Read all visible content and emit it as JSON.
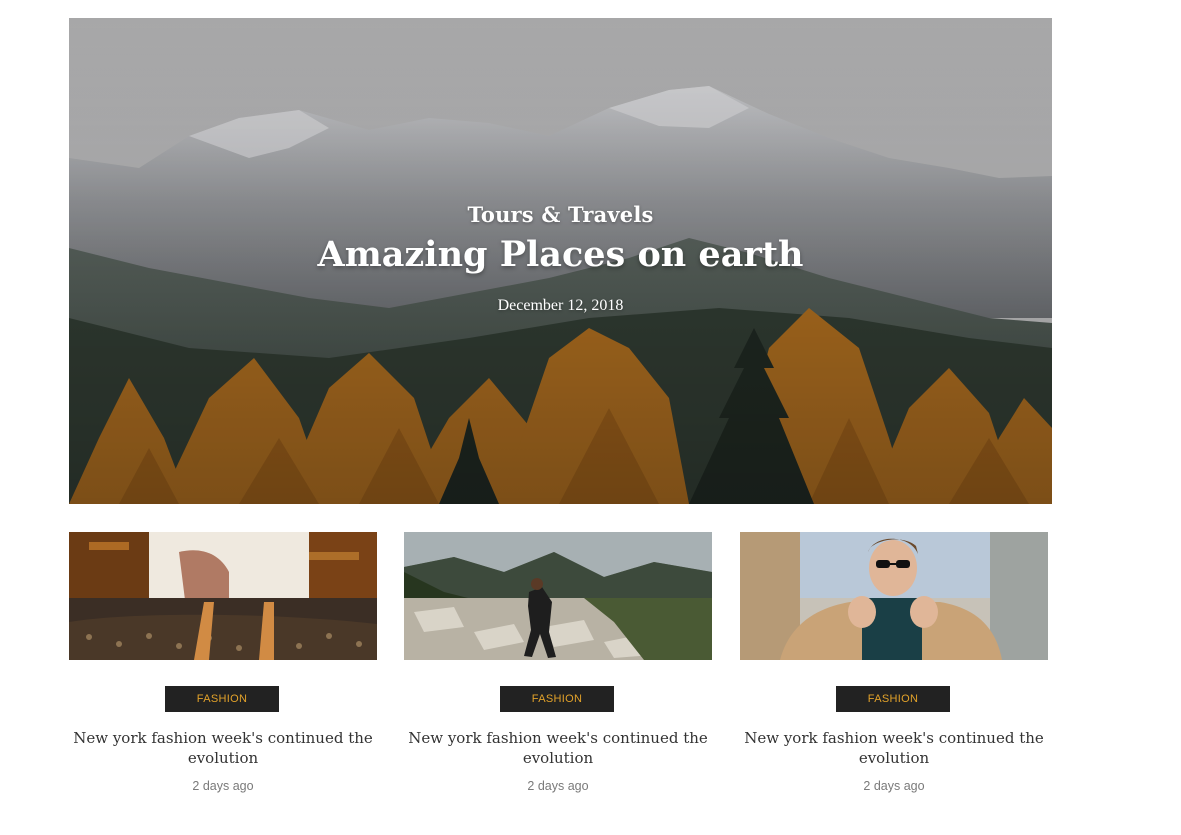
{
  "hero": {
    "category": "Tours & Travels",
    "title": "Amazing Places on earth",
    "date": "December 12, 2018"
  },
  "cards": [
    {
      "category": "FASHION",
      "title": "New york fashion week's continued the evolution",
      "meta": "2 days ago",
      "image": "handbag-photo"
    },
    {
      "category": "FASHION",
      "title": "New york fashion week's continued the evolution",
      "meta": "2 days ago",
      "image": "hiker-photo"
    },
    {
      "category": "FASHION",
      "title": "New york fashion week's continued the evolution",
      "meta": "2 days ago",
      "image": "man-in-coat-photo"
    }
  ],
  "colors": {
    "badge_bg": "#222222",
    "badge_text": "#e2a22a",
    "title_text": "#333333",
    "meta_text": "#7a7a7a"
  }
}
